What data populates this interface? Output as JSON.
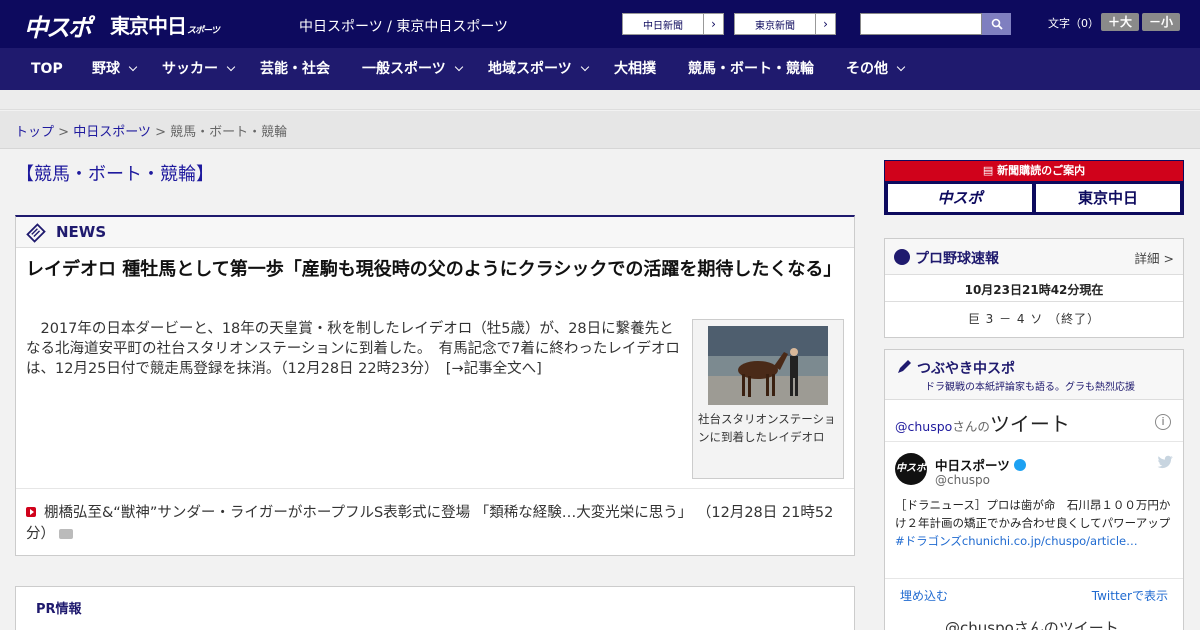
{
  "header": {
    "logo_chuspo": "中スポ",
    "logo_tokyo": "東京中日",
    "logo_tokyo_small": "スポーツ",
    "site_names": "中日スポーツ / 東京中日スポーツ",
    "chunichi_label": "中日新聞",
    "tokyo_label": "東京新聞",
    "font_label": "文字（0）",
    "font_larger": "＋大",
    "font_smaller": "－小"
  },
  "nav": {
    "items": [
      {
        "label": "TOP"
      },
      {
        "label": "野球"
      },
      {
        "label": "サッカー"
      },
      {
        "label": "芸能・社会"
      },
      {
        "label": "一般スポーツ"
      },
      {
        "label": "地域スポーツ"
      },
      {
        "label": "大相撲"
      },
      {
        "label": "競馬・ボート・競輪"
      },
      {
        "label": "その他"
      }
    ]
  },
  "breadcrumb": {
    "top": "トップ",
    "sep1": " > ",
    "chunichi": "中日スポーツ",
    "sep2": " > ",
    "current": "競馬・ボート・競輪"
  },
  "page_title": "【競馬・ボート・競輪】",
  "news": {
    "heading": "NEWS",
    "headline": "レイデオロ 種牡馬として第一歩「産駒も現役時の父のようにクラシックでの活躍を期待したくなる」",
    "lead": "2017年の日本ダービーと、18年の天皇賞・秋を制したレイデオロ（牡5歳）が、28日に繋養先となる北海道安平町の社台スタリオンステーションに到着した。　有馬記念で7着に終わったレイデオロは、12月25日付で競走馬登録を抹消。（12月28日 22時23分）　[→記事全文へ]",
    "photo_caption": "社台スタリオンステーションに到着したレイデオロ",
    "sub_item": "棚橋弘至&“獣神”サンダー・ライガーがホープフルS表彰式に登場 「類稀な経験…大変光栄に思う」 （12月28日 21時52分）"
  },
  "pr": {
    "title": "PR情報"
  },
  "sidebar": {
    "banner_top": "新聞購読のご案内",
    "banner_left": "中スポ",
    "banner_right": "東京中日",
    "baseball": {
      "title": "プロ野球速報",
      "detail": "詳細 >",
      "time": "10月23日21時42分現在",
      "score": "巨 3 － 4 ソ （終了）"
    },
    "tweets": {
      "title": "つぶやき中スポ",
      "subtitle": "ドラ観戦の本紙評論家も語る。グラも熱烈応援",
      "account_prefix": "@chuspo",
      "account_suffix": "さんの",
      "account_big": "ツイート",
      "name": "中日スポーツ",
      "handle": "@chuspo",
      "avatar": "中スポ",
      "text": "［ドラニュース］プロは歯が命　石川昂１００万円かけ２年計画の矯正でかみ合わせ良くしてパワーアップ",
      "link": "#ドラゴンズchunichi.co.jp/chuspo/article…",
      "embed": "埋め込む",
      "view_on_twitter": "Twitterで表示",
      "bottom": "@chuspoさんのツイート"
    }
  },
  "colors": {
    "header_bg": "#0d0a5e",
    "nav_bg": "#1f1a6e",
    "link": "#1f1a9e",
    "accent_red": "#d0021b"
  }
}
